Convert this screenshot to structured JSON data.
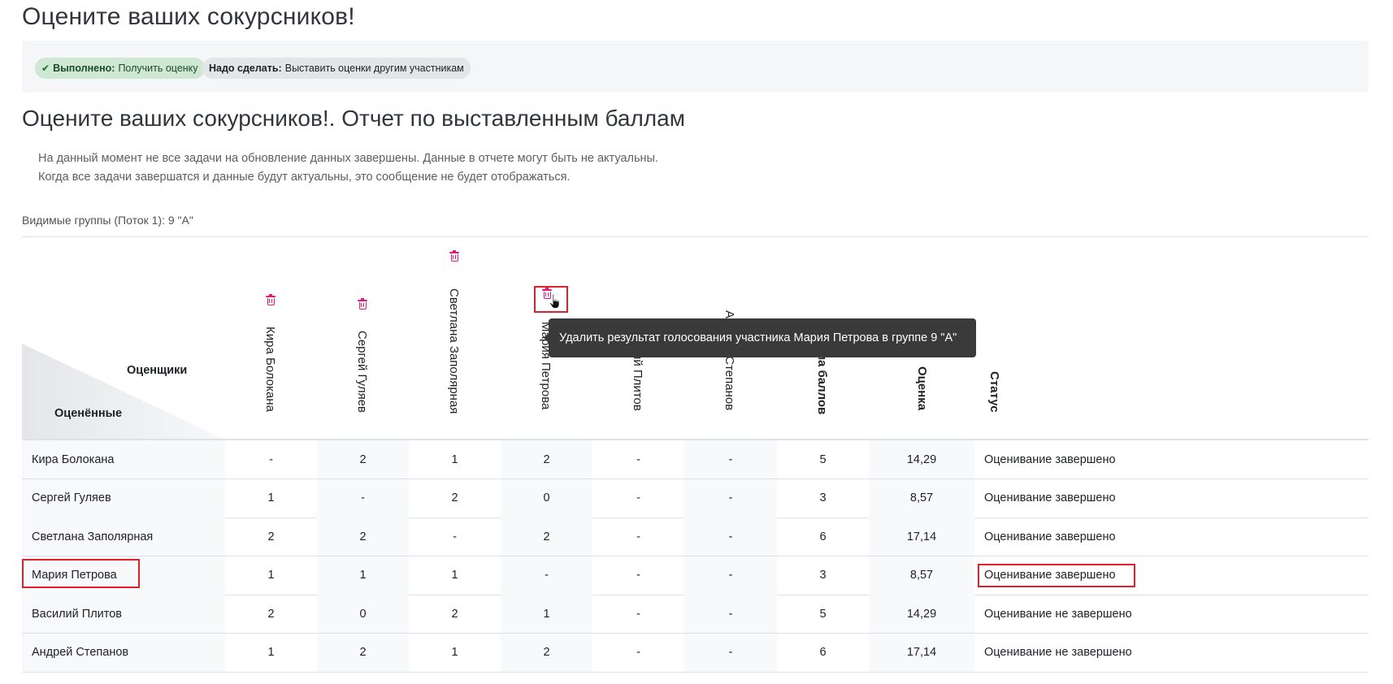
{
  "page": {
    "title": "Оцените ваших сокурсников!",
    "report_title": "Оцените ваших сокурсников!. Отчет по выставленным баллам"
  },
  "completion": {
    "done_label": "Выполнено:",
    "done_value": "Получить оценку",
    "todo_label": "Надо сделать:",
    "todo_value": "Выставить оценки другим участникам"
  },
  "notice": {
    "line1": "На данный момент не все задачи на обновление данных завершены. Данные в отчете могут быть не актуальны.",
    "line2": "Когда все задачи завершатся и данные будут актуальны, это сообщение не будет отображаться."
  },
  "groups": {
    "label": "Видимые группы (Поток 1):",
    "value": "9 \"А\""
  },
  "table": {
    "corner_graders": "Оценщики",
    "corner_graded": "Оценённые",
    "columns": [
      "Кира Болокана",
      "Сергей Гуляев",
      "Светлана Заполярная",
      "Мария Петрова",
      "Василий Плитов",
      "Андрей Степанов",
      "Сумма баллов",
      "Оценка",
      "Статус"
    ],
    "rows": [
      {
        "name": "Кира Болокана",
        "cells": [
          "-",
          "2",
          "1",
          "2",
          "-",
          "-",
          "5",
          "14,29",
          "Оценивание завершено"
        ]
      },
      {
        "name": "Сергей Гуляев",
        "cells": [
          "1",
          "-",
          "2",
          "0",
          "-",
          "-",
          "3",
          "8,57",
          "Оценивание завершено"
        ]
      },
      {
        "name": "Светлана Заполярная",
        "cells": [
          "2",
          "2",
          "-",
          "2",
          "-",
          "-",
          "6",
          "17,14",
          "Оценивание завершено"
        ]
      },
      {
        "name": "Мария Петрова",
        "cells": [
          "1",
          "1",
          "1",
          "-",
          "-",
          "-",
          "3",
          "8,57",
          "Оценивание завершено"
        ]
      },
      {
        "name": "Василий Плитов",
        "cells": [
          "2",
          "0",
          "2",
          "1",
          "-",
          "-",
          "5",
          "14,29",
          "Оценивание не завершено"
        ]
      },
      {
        "name": "Андрей Степанов",
        "cells": [
          "1",
          "2",
          "1",
          "2",
          "-",
          "-",
          "6",
          "17,14",
          "Оценивание не завершено"
        ]
      }
    ]
  },
  "tooltip": {
    "text": "Удалить результат голосования участника Мария Петрова в группе 9 \"А\""
  },
  "colors": {
    "accent_delete": "#e5197c",
    "highlight": "#e0202a",
    "done_bg": "#cfe8d3",
    "tooltip_bg": "#3a3a3a"
  }
}
